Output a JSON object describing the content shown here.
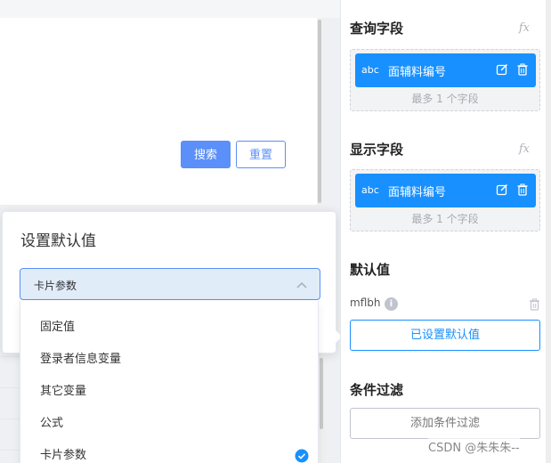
{
  "search_area": {
    "search_label": "搜索",
    "reset_label": "重置"
  },
  "popover": {
    "title": "设置默认值",
    "select": {
      "value": "卡片参数"
    },
    "options": [
      {
        "label": "固定值"
      },
      {
        "label": "登录者信息变量"
      },
      {
        "label": "其它变量"
      },
      {
        "label": "公式"
      },
      {
        "label": "卡片参数",
        "selected": true
      }
    ]
  },
  "panel": {
    "query": {
      "title": "查询字段",
      "fx": "fx",
      "chip": {
        "type": "abc",
        "label": "面辅料编号"
      },
      "hint": "最多 1 个字段"
    },
    "display": {
      "title": "显示字段",
      "fx": "fx",
      "chip": {
        "type": "abc",
        "label": "面辅料编号"
      },
      "hint": "最多 1 个字段"
    },
    "default": {
      "title": "默认值",
      "name": "mflbh",
      "info": "i",
      "button": "已设置默认值"
    },
    "filter": {
      "title": "条件过滤",
      "button": "添加条件过滤"
    }
  },
  "colors": {
    "primary": "#1890ff",
    "search_button": "#5b8ff9",
    "select_bg": "#e0ecf8"
  },
  "watermark": "CSDN @朱朱朱--"
}
